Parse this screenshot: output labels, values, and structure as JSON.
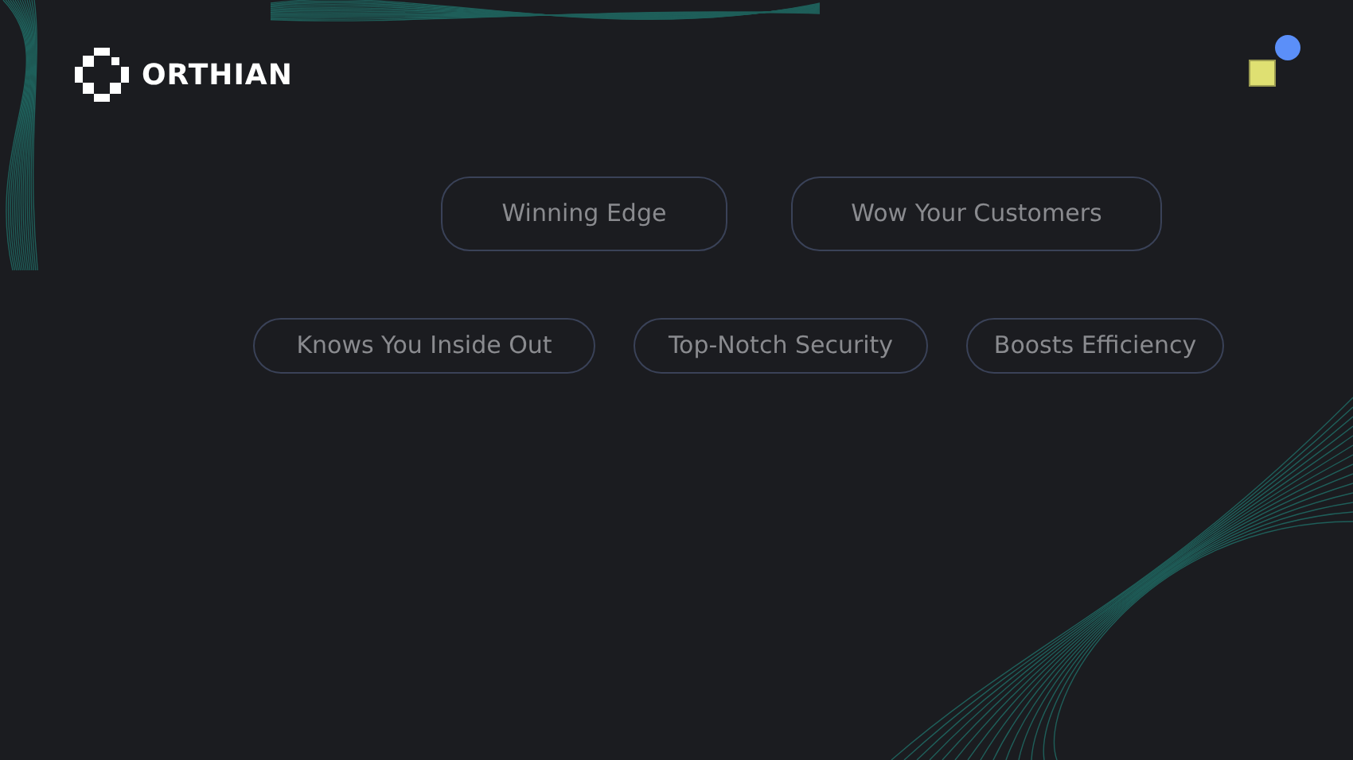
{
  "brand": {
    "name": "ORTHIAN"
  },
  "tags": [
    [
      {
        "label": "Winning Edge"
      },
      {
        "label": "Wow Your Customers"
      }
    ],
    [
      {
        "label": "Knows You Inside Out"
      },
      {
        "label": "Top-Notch Security"
      },
      {
        "label": "Boosts Efficiency"
      }
    ]
  ]
}
